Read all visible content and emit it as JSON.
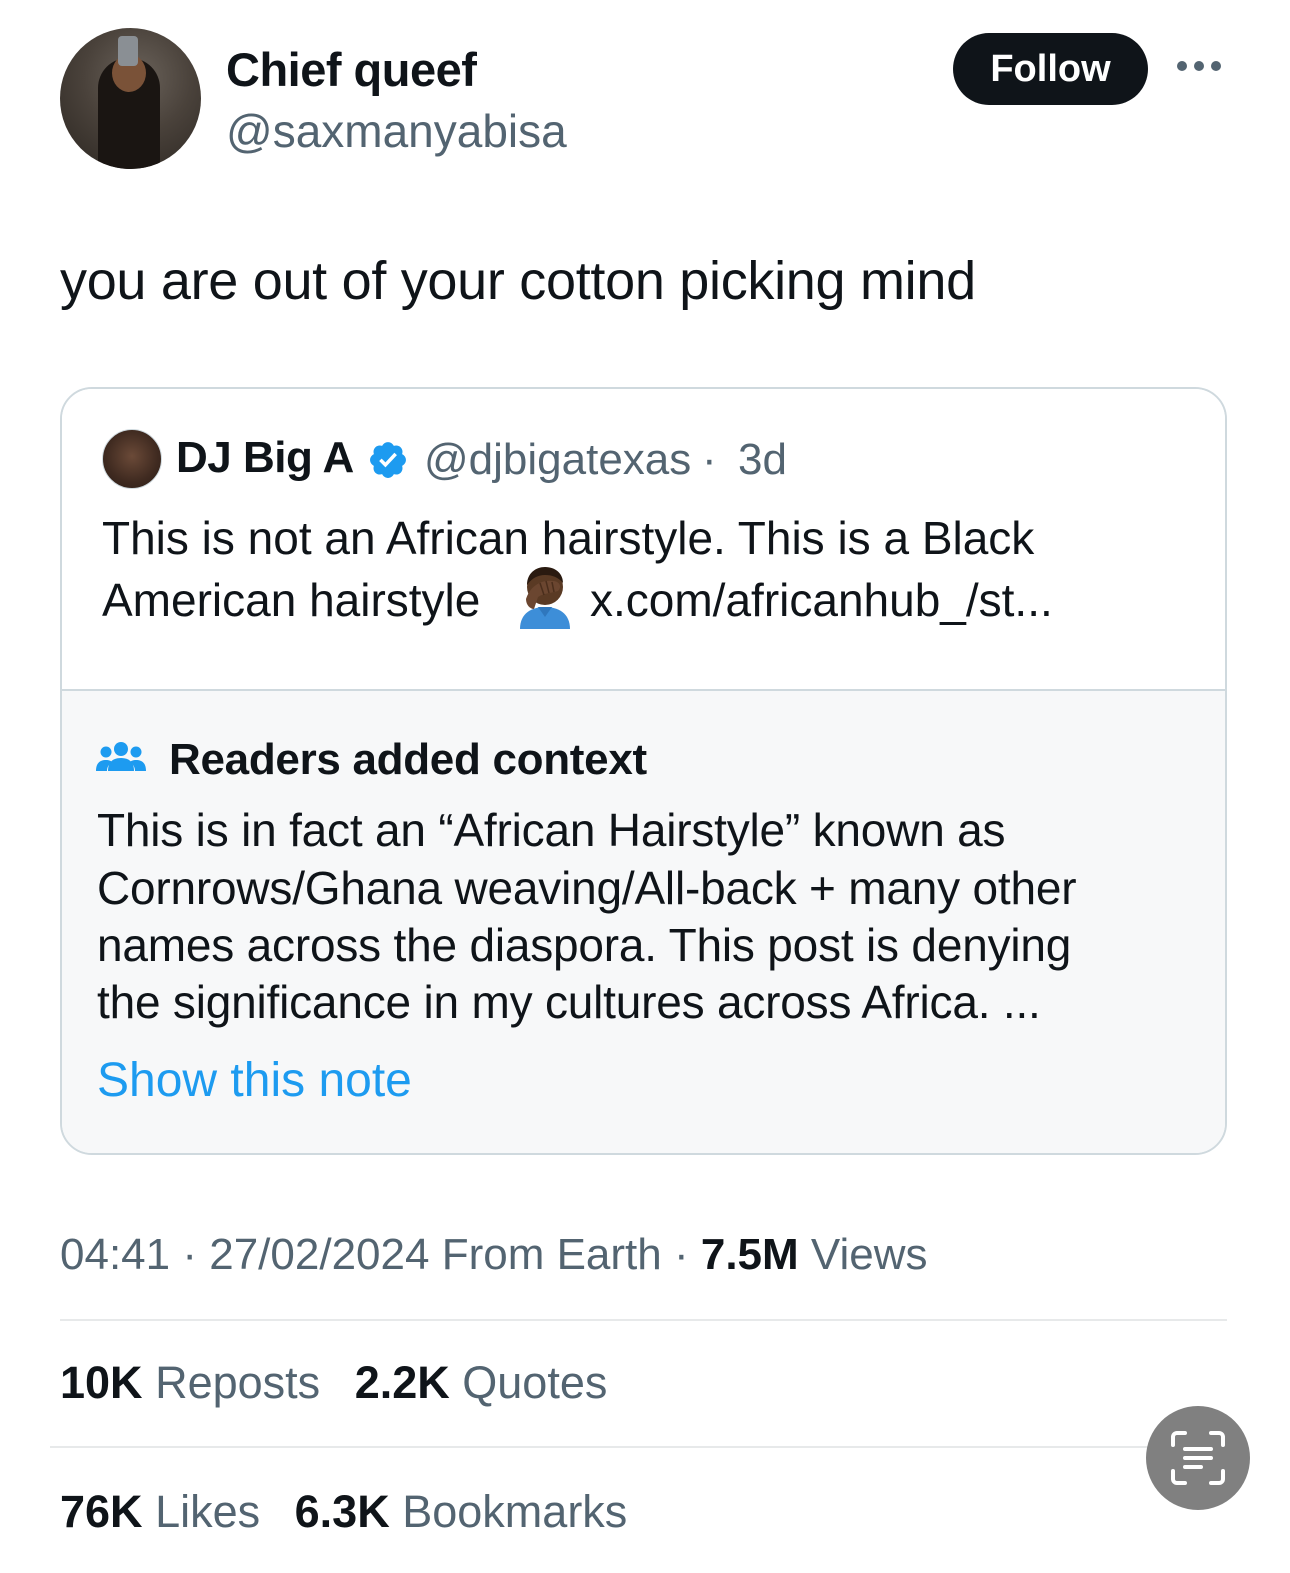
{
  "author": {
    "name": "Chief queef",
    "handle": "@saxmanyabisa"
  },
  "follow_label": "Follow",
  "tweet_text": "you are out of your cotton picking mind",
  "quoted": {
    "name": "DJ Big A",
    "handle": "@djbigatexas",
    "separator": "·",
    "time": "3d",
    "text_line1": "This is not an African hairstyle. This is a Black",
    "text_line2": "American hairstyle",
    "emoji_icon": "facepalm-emoji",
    "link": "x.com/africanhub_/st..."
  },
  "community_note": {
    "title": "Readers added context",
    "lines": [
      "This is in fact an “African Hairstyle” known as",
      "Cornrows/Ghana weaving/All-back + many other",
      "names across the diaspora. This post is denying",
      "the significance in my cultures across Africa. ..."
    ],
    "show_note_label": "Show this note"
  },
  "meta": {
    "time": "04:41",
    "date": "27/02/2024",
    "source": "From Earth",
    "views_count": "7.5M",
    "views_label": "Views",
    "separator": "·"
  },
  "stats": {
    "reposts_count": "10K",
    "reposts_label": "Reposts",
    "quotes_count": "2.2K",
    "quotes_label": "Quotes",
    "likes_count": "76K",
    "likes_label": "Likes",
    "bookmarks_count": "6.3K",
    "bookmarks_label": "Bookmarks"
  },
  "colors": {
    "text_primary": "#0f1419",
    "text_secondary": "#536471",
    "link_blue": "#1d9bf0",
    "verified_blue": "#1d9bf0",
    "border": "#cfd9de",
    "note_background": "#f7f8f9"
  },
  "icons": {
    "more": "more-horizontal-icon",
    "verified": "verified-badge-icon",
    "community_notes": "people-icon",
    "scan": "text-scan-icon"
  }
}
